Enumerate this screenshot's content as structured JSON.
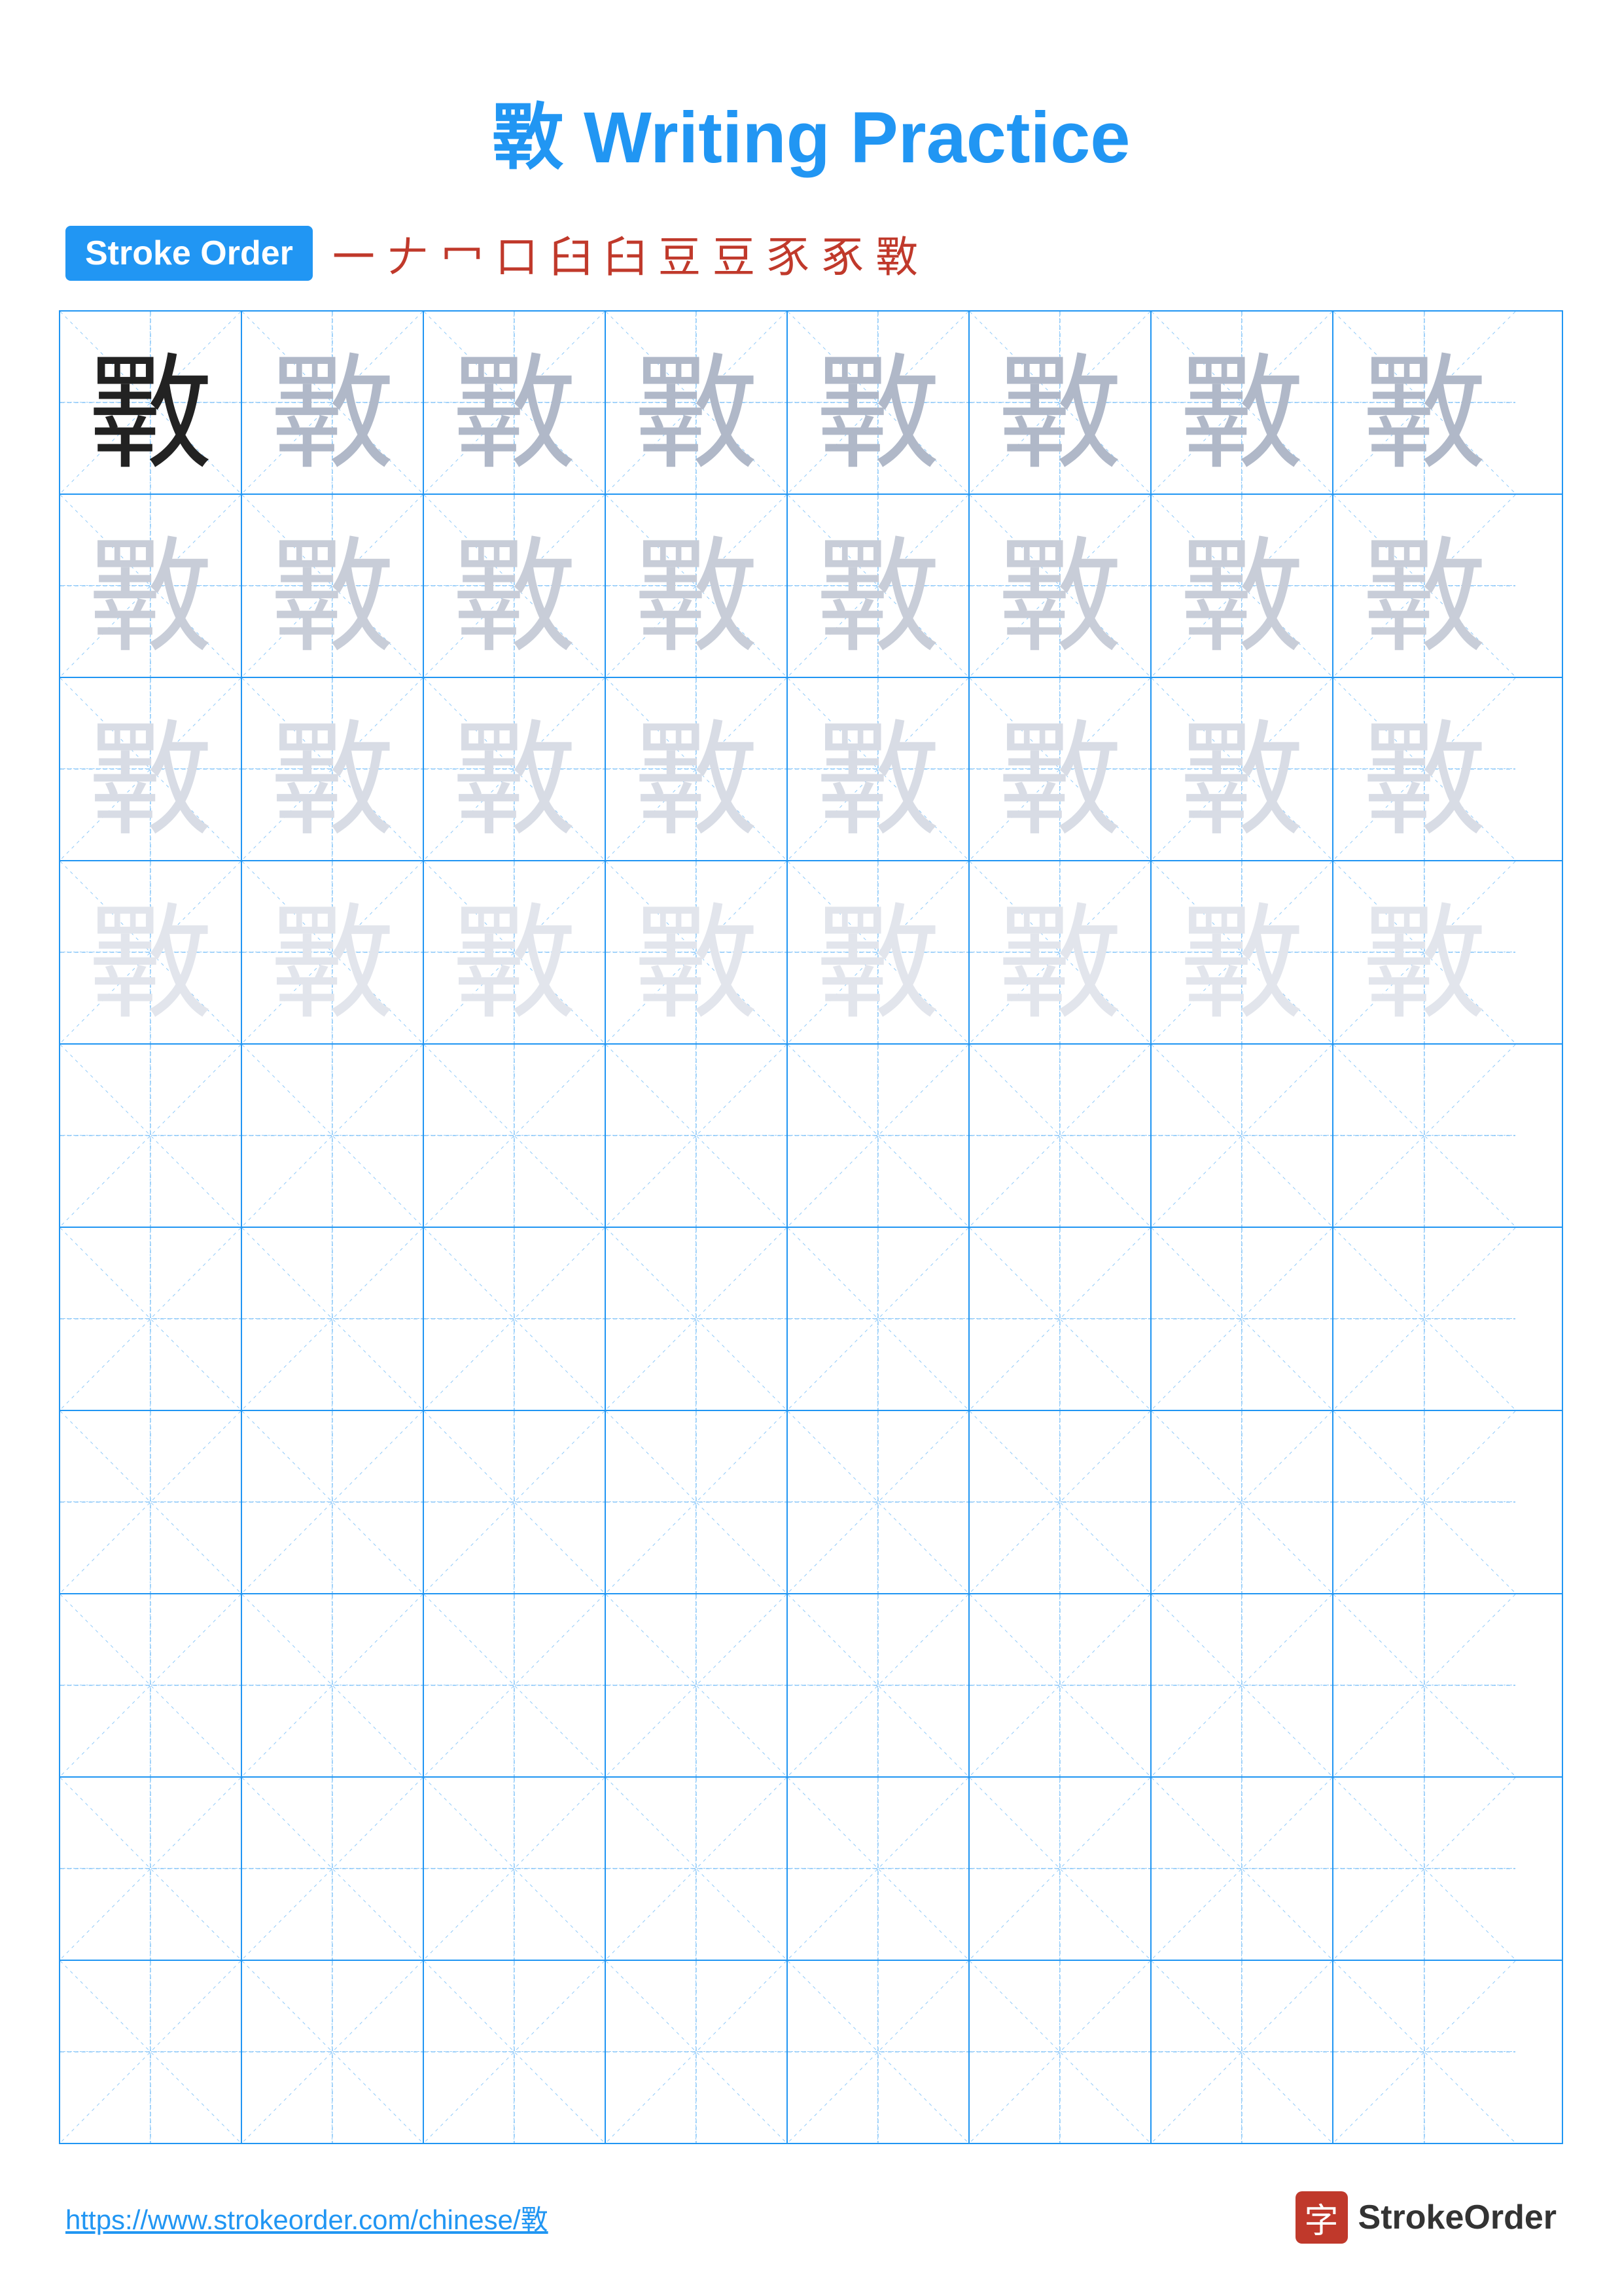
{
  "title": "斁 Writing Practice",
  "stroke_order": {
    "label": "Stroke Order",
    "chars": [
      "一",
      "𠂇",
      "冖",
      "口",
      "臼",
      "臼",
      "豆",
      "豆",
      "豖",
      "豗",
      "斁"
    ]
  },
  "main_char": "斁",
  "grid": {
    "rows": 10,
    "cols": 8
  },
  "footer": {
    "url": "https://www.strokeorder.com/chinese/斁",
    "logo_char": "字",
    "logo_text": "StrokeOrder"
  },
  "char_opacities": {
    "row0": "dark",
    "row1": "light1",
    "row2": "light2",
    "row3": "light3",
    "row4": "light4",
    "row5": "empty",
    "row6": "empty",
    "row7": "empty",
    "row8": "empty",
    "row9": "empty"
  }
}
